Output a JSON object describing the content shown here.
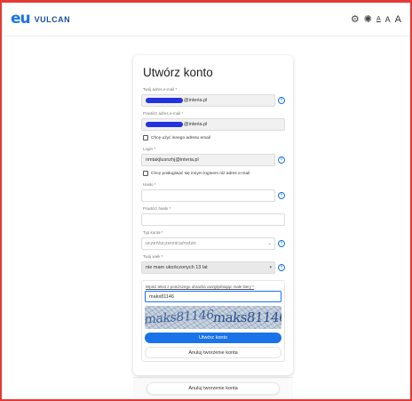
{
  "header": {
    "logo_mark": "eu",
    "logo_text": "VULCAN",
    "icon_settings": "settings-icon",
    "icon_contrast": "contrast-icon",
    "font_small": "A",
    "font_medium": "A",
    "font_large": "A"
  },
  "form": {
    "title": "Utwórz konto",
    "email_label": "Twój adres e-mail *",
    "email_value": "@interia.pl",
    "email_repeat_label": "Powtórz adres e-mail *",
    "email_repeat_value": "@interia.pl",
    "other_email_checkbox": "Chcę użyć innego adresu email",
    "login_label": "Login *",
    "login_value": "nmtakjlusnzhj@interia.pl",
    "other_login_checkbox": "Chcę posługiwać się innym loginem niż adres e-mail",
    "password_label": "Hasło *",
    "password_value": "",
    "password_repeat_label": "Powtórz hasło *",
    "password_repeat_value": "",
    "account_type_label": "Typ konta *",
    "account_type_value": "uczeń/uczennica/rodzic",
    "age_label": "Twój wiek *",
    "age_value": "nie mam ukończonych 13 lat",
    "captcha_question": "Wpisz tekst z poniższego obrazka uwzględniając małe litery *",
    "captcha_value": "maks81146",
    "captcha_image_text_1": "maks81146",
    "captcha_image_text_2": "maks81146",
    "create_button": "Utwórz konto",
    "cancel_button": "Anuluj tworzenie konta"
  },
  "footer": {
    "cancel_button": "Anuluj tworzenie konta"
  },
  "colors": {
    "accent": "#1a73e8",
    "frame": "#e53935"
  }
}
